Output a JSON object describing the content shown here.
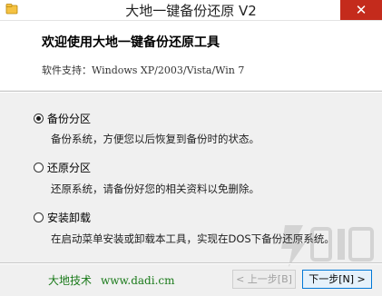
{
  "window": {
    "title": "大地一键备份还原 V2",
    "close_glyph": "✕"
  },
  "header": {
    "welcome": "欢迎使用大地一键备份还原工具",
    "support_label": "软件支持：",
    "support_os": "Windows XP/2003/Vista/Win 7"
  },
  "options": [
    {
      "label": "备份分区",
      "description": "备份系统，方便您以后恢复到备份时的状态。",
      "selected": true
    },
    {
      "label": "还原分区",
      "description": "还原系统，请备份好您的相关资料以免删除。",
      "selected": false
    },
    {
      "label": "安装卸载",
      "description": "在启动菜单安装或卸载本工具，实现在DOS下备份还原系统。",
      "selected": false
    }
  ],
  "footer": {
    "brand": "大地技术",
    "url": "www.dadi.cm",
    "prev_button": "< 上一步[B]",
    "next_button": "下一步[N] >"
  },
  "colors": {
    "brand_green": "#1a7a1a",
    "close_red": "#c42b1c",
    "focus_blue": "#0078d7"
  }
}
